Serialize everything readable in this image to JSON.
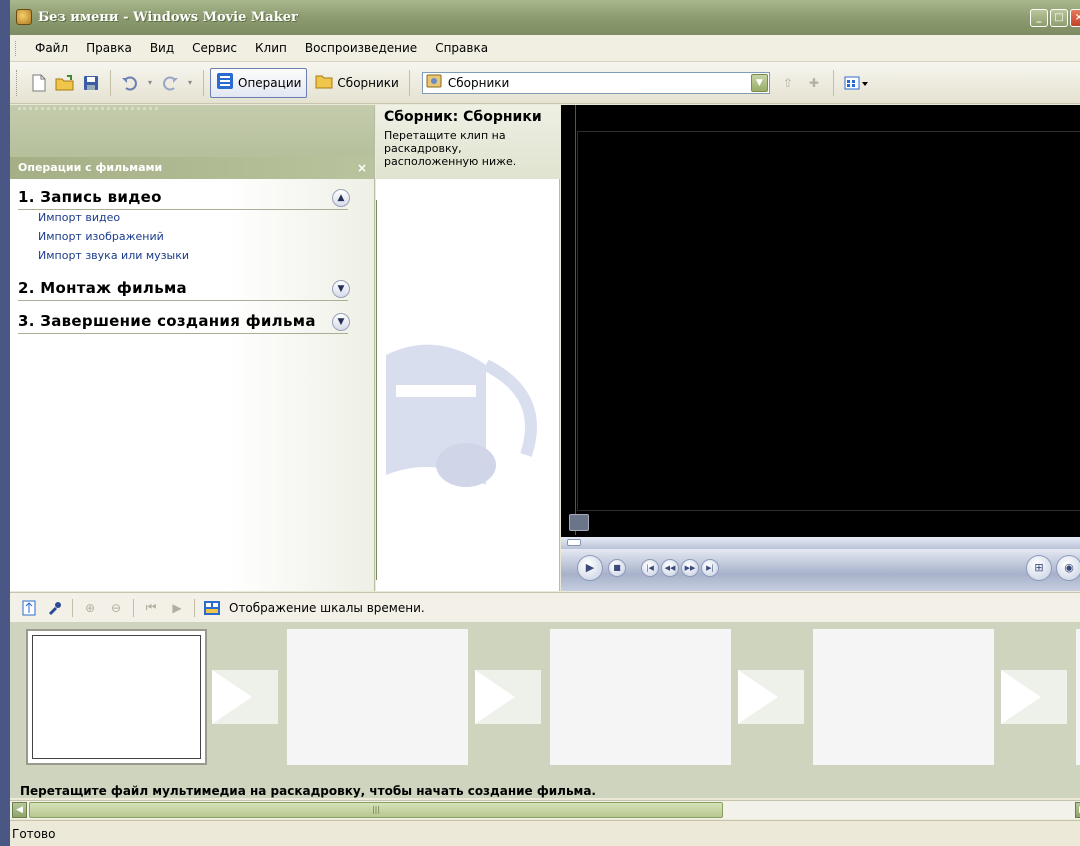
{
  "window": {
    "title": "Без имени - Windows Movie Maker"
  },
  "menu": [
    "Файл",
    "Правка",
    "Вид",
    "Сервис",
    "Клип",
    "Воспроизведение",
    "Справка"
  ],
  "toolbar": {
    "operations_label": "Операции",
    "collections_label": "Сборники",
    "collection_combo_value": "Сборники"
  },
  "tasks": {
    "header": "Операции с фильмами",
    "close": "×",
    "sections": [
      {
        "title": "1. Запись видео",
        "links": [
          "Импорт видео",
          "Импорт изображений",
          "Импорт звука или музыки"
        ]
      },
      {
        "title": "2. Монтаж фильма"
      },
      {
        "title": "3. Завершение создания фильма"
      }
    ]
  },
  "collection": {
    "title": "Сборник: Сборники",
    "description": "Перетащите клип на раскадровку, расположенную ниже."
  },
  "timeline": {
    "toggle_label": "Отображение шкалы времени.",
    "hint": "Перетащите файл мультимедиа на раскадровку, чтобы начать создание фильма."
  },
  "status": {
    "text": "Готово"
  },
  "colors": {
    "title_bar": "#8c9c70",
    "accent": "#b0ba92",
    "preview_bg": "#000000",
    "link": "#1a3c8c"
  }
}
